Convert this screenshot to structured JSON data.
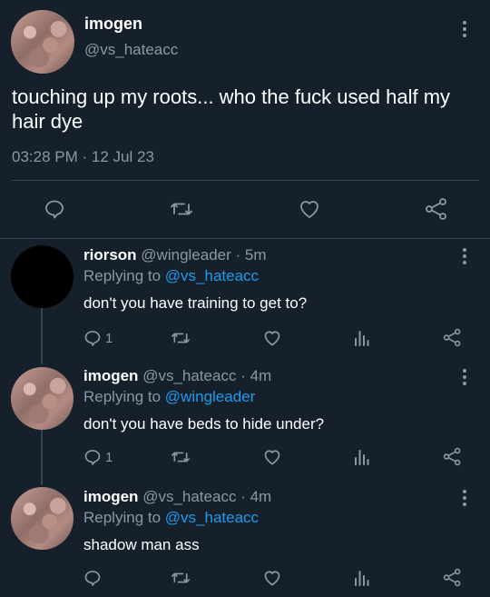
{
  "main_tweet": {
    "display_name": "imogen",
    "handle": "@vs_hateacc",
    "text": "touching up my roots... who the fuck used half my hair dye",
    "time": "03:28 PM",
    "separator": "·",
    "date": "12 Jul 23"
  },
  "replies": [
    {
      "display_name": "riorson",
      "handle": "@wingleader",
      "dot": "·",
      "age": "5m",
      "replying_prefix": "Replying to",
      "replying_to": "@vs_hateacc",
      "text": "don't you have training to get to?",
      "reply_count": "1",
      "avatar": "dark"
    },
    {
      "display_name": "imogen",
      "handle": "@vs_hateacc",
      "dot": "·",
      "age": "4m",
      "replying_prefix": "Replying to",
      "replying_to": "@wingleader",
      "text": "don't you have beds to hide under?",
      "reply_count": "1",
      "avatar": "hair"
    },
    {
      "display_name": "imogen",
      "handle": "@vs_hateacc",
      "dot": "·",
      "age": "4m",
      "replying_prefix": "Replying to",
      "replying_to": "@vs_hateacc",
      "text": "shadow man ass",
      "reply_count": "",
      "avatar": "hair"
    }
  ],
  "icons": {
    "reply": "reply-icon",
    "retweet": "retweet-icon",
    "like": "heart-icon",
    "share": "share-icon",
    "analytics": "analytics-icon",
    "more": "more-options-icon"
  },
  "colors": {
    "background": "#15202b",
    "text": "#ffffff",
    "muted": "#8899a6",
    "link": "#1d9bf0",
    "divider": "#38444d"
  }
}
